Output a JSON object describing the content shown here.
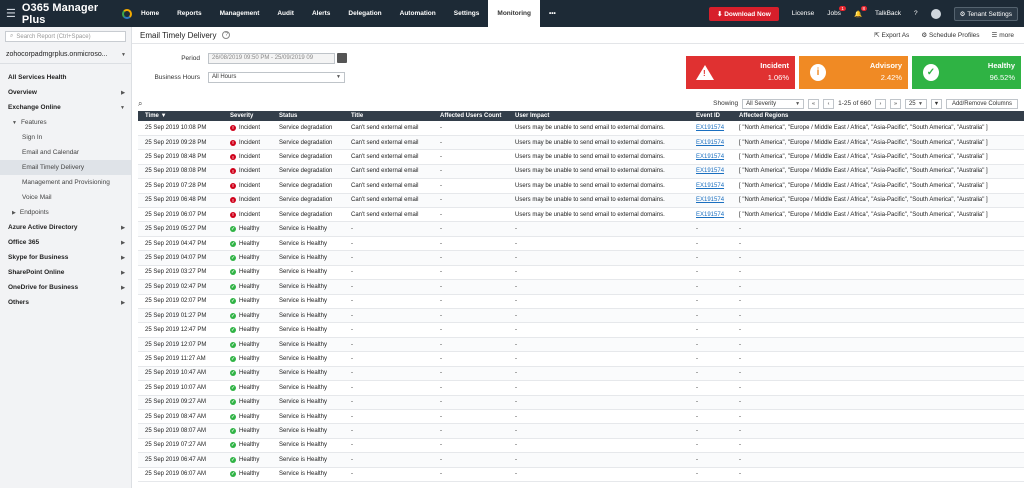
{
  "app": {
    "name": "O365 Manager Plus"
  },
  "topnav": {
    "tabs": [
      "Home",
      "Reports",
      "Management",
      "Audit",
      "Alerts",
      "Delegation",
      "Automation",
      "Settings",
      "Monitoring",
      "•••"
    ],
    "active_index": 8
  },
  "topright": {
    "download": "Download Now",
    "license": "License",
    "jobs": "Jobs",
    "jobs_badge": "1",
    "notif_badge": "8",
    "talkback": "TalkBack",
    "help": "?",
    "tenant_settings": "Tenant Settings"
  },
  "sidebar": {
    "search_placeholder": "Search Report (Ctrl+Space)",
    "tenant": "zohocorpadmgrplus.onmicroso...",
    "items": [
      {
        "label": "All Services Health",
        "level": 0,
        "arrow": ""
      },
      {
        "label": "Overview",
        "level": 0,
        "arrow": "▶"
      },
      {
        "label": "Exchange Online",
        "level": 0,
        "arrow": "▼"
      },
      {
        "label": "Features",
        "level": 1,
        "arrow": "▼"
      },
      {
        "label": "Sign In",
        "level": 2,
        "arrow": ""
      },
      {
        "label": "Email and Calendar",
        "level": 2,
        "arrow": ""
      },
      {
        "label": "Email Timely Delivery",
        "level": 2,
        "arrow": "",
        "active": true
      },
      {
        "label": "Management and Provisioning",
        "level": 2,
        "arrow": ""
      },
      {
        "label": "Voice Mail",
        "level": 2,
        "arrow": ""
      },
      {
        "label": "Endpoints",
        "level": 1,
        "arrow": "▶"
      },
      {
        "label": "Azure Active Directory",
        "level": 0,
        "arrow": "▶"
      },
      {
        "label": "Office 365",
        "level": 0,
        "arrow": "▶"
      },
      {
        "label": "Skype for Business",
        "level": 0,
        "arrow": "▶"
      },
      {
        "label": "SharePoint Online",
        "level": 0,
        "arrow": "▶"
      },
      {
        "label": "OneDrive for Business",
        "level": 0,
        "arrow": "▶"
      },
      {
        "label": "Others",
        "level": 0,
        "arrow": "▶"
      }
    ]
  },
  "page": {
    "title": "Email Timely Delivery",
    "actions": {
      "export": "Export As",
      "schedule": "Schedule Profiles",
      "more": "more"
    },
    "period_label": "Period",
    "period_value": "26/08/2019 09:50 PM - 25/09/2019 09",
    "business_hours_label": "Business Hours",
    "business_hours_value": "All Hours"
  },
  "cards": [
    {
      "key": "incident",
      "title": "Incident",
      "value": "1.06%",
      "color": "#e03131"
    },
    {
      "key": "advisory",
      "title": "Advisory",
      "value": "2.42%",
      "color": "#f08a24"
    },
    {
      "key": "healthy",
      "title": "Healthy",
      "value": "96.52%",
      "color": "#2fb344"
    }
  ],
  "toolbar": {
    "showing_label": "Showing",
    "severity_filter": "All Severity",
    "page_info": "1-25 of 660",
    "page_size": "25",
    "add_remove": "Add/Remove Columns"
  },
  "table": {
    "columns": [
      "Time",
      "Severity",
      "Status",
      "Title",
      "Affected Users Count",
      "User Impact",
      "Event ID",
      "Affected Regions"
    ],
    "rows": [
      [
        "25 Sep 2019 10:08 PM",
        "Incident",
        "Service degradation",
        "Can't send external email",
        "-",
        "Users may be unable to send email to external domains.",
        "EX191574",
        "[ \"North America\", \"Europe / Middle East / Africa\", \"Asia-Pacific\", \"South America\", \"Australia\" ]"
      ],
      [
        "25 Sep 2019 09:28 PM",
        "Incident",
        "Service degradation",
        "Can't send external email",
        "-",
        "Users may be unable to send email to external domains.",
        "EX191574",
        "[ \"North America\", \"Europe / Middle East / Africa\", \"Asia-Pacific\", \"South America\", \"Australia\" ]"
      ],
      [
        "25 Sep 2019 08:48 PM",
        "Incident",
        "Service degradation",
        "Can't send external email",
        "-",
        "Users may be unable to send email to external domains.",
        "EX191574",
        "[ \"North America\", \"Europe / Middle East / Africa\", \"Asia-Pacific\", \"South America\", \"Australia\" ]"
      ],
      [
        "25 Sep 2019 08:08 PM",
        "Incident",
        "Service degradation",
        "Can't send external email",
        "-",
        "Users may be unable to send email to external domains.",
        "EX191574",
        "[ \"North America\", \"Europe / Middle East / Africa\", \"Asia-Pacific\", \"South America\", \"Australia\" ]"
      ],
      [
        "25 Sep 2019 07:28 PM",
        "Incident",
        "Service degradation",
        "Can't send external email",
        "-",
        "Users may be unable to send email to external domains.",
        "EX191574",
        "[ \"North America\", \"Europe / Middle East / Africa\", \"Asia-Pacific\", \"South America\", \"Australia\" ]"
      ],
      [
        "25 Sep 2019 06:48 PM",
        "Incident",
        "Service degradation",
        "Can't send external email",
        "-",
        "Users may be unable to send email to external domains.",
        "EX191574",
        "[ \"North America\", \"Europe / Middle East / Africa\", \"Asia-Pacific\", \"South America\", \"Australia\" ]"
      ],
      [
        "25 Sep 2019 06:07 PM",
        "Incident",
        "Service degradation",
        "Can't send external email",
        "-",
        "Users may be unable to send email to external domains.",
        "EX191574",
        "[ \"North America\", \"Europe / Middle East / Africa\", \"Asia-Pacific\", \"South America\", \"Australia\" ]"
      ],
      [
        "25 Sep 2019 05:27 PM",
        "Healthy",
        "Service is Healthy",
        "-",
        "-",
        "-",
        "-",
        "-"
      ],
      [
        "25 Sep 2019 04:47 PM",
        "Healthy",
        "Service is Healthy",
        "-",
        "-",
        "-",
        "-",
        "-"
      ],
      [
        "25 Sep 2019 04:07 PM",
        "Healthy",
        "Service is Healthy",
        "-",
        "-",
        "-",
        "-",
        "-"
      ],
      [
        "25 Sep 2019 03:27 PM",
        "Healthy",
        "Service is Healthy",
        "-",
        "-",
        "-",
        "-",
        "-"
      ],
      [
        "25 Sep 2019 02:47 PM",
        "Healthy",
        "Service is Healthy",
        "-",
        "-",
        "-",
        "-",
        "-"
      ],
      [
        "25 Sep 2019 02:07 PM",
        "Healthy",
        "Service is Healthy",
        "-",
        "-",
        "-",
        "-",
        "-"
      ],
      [
        "25 Sep 2019 01:27 PM",
        "Healthy",
        "Service is Healthy",
        "-",
        "-",
        "-",
        "-",
        "-"
      ],
      [
        "25 Sep 2019 12:47 PM",
        "Healthy",
        "Service is Healthy",
        "-",
        "-",
        "-",
        "-",
        "-"
      ],
      [
        "25 Sep 2019 12:07 PM",
        "Healthy",
        "Service is Healthy",
        "-",
        "-",
        "-",
        "-",
        "-"
      ],
      [
        "25 Sep 2019 11:27 AM",
        "Healthy",
        "Service is Healthy",
        "-",
        "-",
        "-",
        "-",
        "-"
      ],
      [
        "25 Sep 2019 10:47 AM",
        "Healthy",
        "Service is Healthy",
        "-",
        "-",
        "-",
        "-",
        "-"
      ],
      [
        "25 Sep 2019 10:07 AM",
        "Healthy",
        "Service is Healthy",
        "-",
        "-",
        "-",
        "-",
        "-"
      ],
      [
        "25 Sep 2019 09:27 AM",
        "Healthy",
        "Service is Healthy",
        "-",
        "-",
        "-",
        "-",
        "-"
      ],
      [
        "25 Sep 2019 08:47 AM",
        "Healthy",
        "Service is Healthy",
        "-",
        "-",
        "-",
        "-",
        "-"
      ],
      [
        "25 Sep 2019 08:07 AM",
        "Healthy",
        "Service is Healthy",
        "-",
        "-",
        "-",
        "-",
        "-"
      ],
      [
        "25 Sep 2019 07:27 AM",
        "Healthy",
        "Service is Healthy",
        "-",
        "-",
        "-",
        "-",
        "-"
      ],
      [
        "25 Sep 2019 06:47 AM",
        "Healthy",
        "Service is Healthy",
        "-",
        "-",
        "-",
        "-",
        "-"
      ],
      [
        "25 Sep 2019 06:07 AM",
        "Healthy",
        "Service is Healthy",
        "-",
        "-",
        "-",
        "-",
        "-"
      ]
    ]
  }
}
